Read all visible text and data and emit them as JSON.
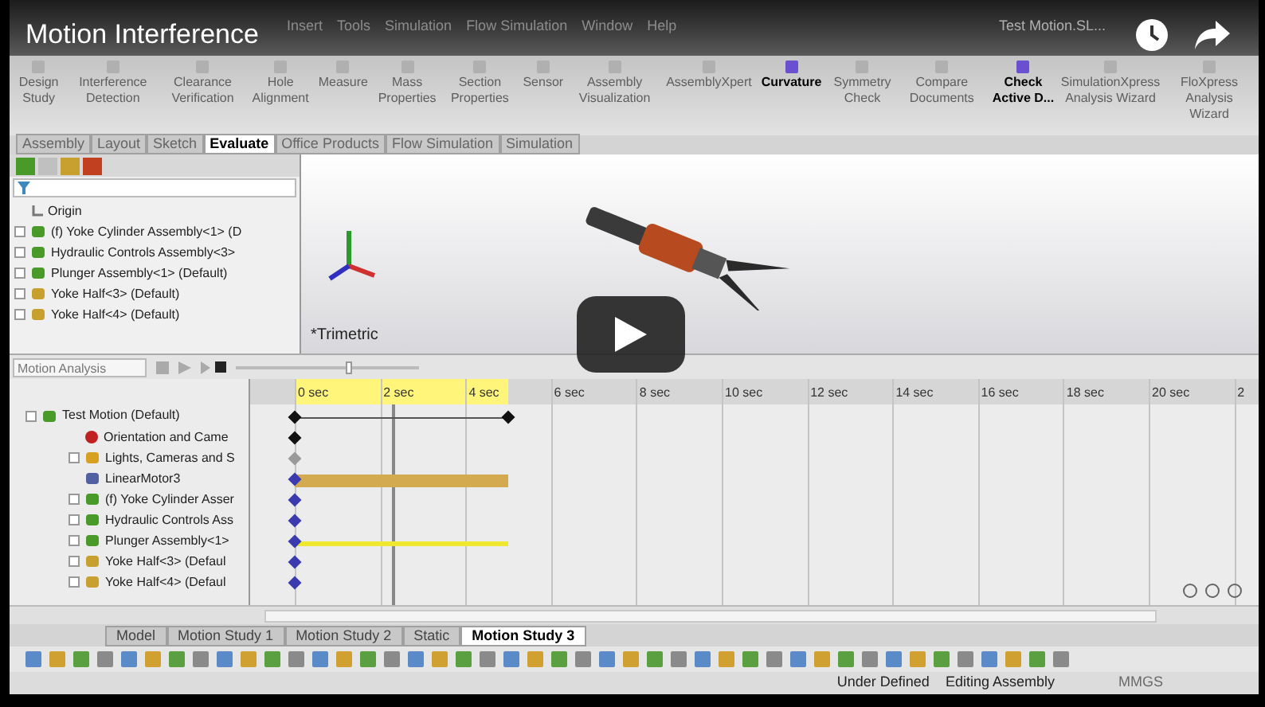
{
  "video": {
    "title": "Motion Interference"
  },
  "menu": [
    "Insert",
    "Tools",
    "Simulation",
    "Flow Simulation",
    "Window",
    "Help"
  ],
  "document_title": "Test Motion.SL...",
  "ribbon": [
    {
      "label": "Design Study",
      "disabled": true
    },
    {
      "label": "Interference Detection",
      "disabled": true
    },
    {
      "label": "Clearance Verification",
      "disabled": true
    },
    {
      "label": "Hole Alignment",
      "disabled": true
    },
    {
      "label": "Measure",
      "disabled": true
    },
    {
      "label": "Mass Properties",
      "disabled": true
    },
    {
      "label": "Section Properties",
      "disabled": true
    },
    {
      "label": "Sensor",
      "disabled": true
    },
    {
      "label": "Assembly Visualization",
      "disabled": true
    },
    {
      "label": "AssemblyXpert",
      "disabled": true
    },
    {
      "label": "Curvature",
      "disabled": false
    },
    {
      "label": "Symmetry Check",
      "disabled": true
    },
    {
      "label": "Compare Documents",
      "disabled": true
    },
    {
      "label": "Check Active D...",
      "disabled": false
    },
    {
      "label": "SimulationXpress Analysis Wizard",
      "disabled": true
    },
    {
      "label": "FloXpress Analysis Wizard",
      "disabled": true
    }
  ],
  "tabs": [
    {
      "label": "Assembly",
      "selected": false
    },
    {
      "label": "Layout",
      "selected": false
    },
    {
      "label": "Sketch",
      "selected": false
    },
    {
      "label": "Evaluate",
      "selected": true
    },
    {
      "label": "Office Products",
      "selected": false
    },
    {
      "label": "Flow Simulation",
      "selected": false
    },
    {
      "label": "Simulation",
      "selected": false
    }
  ],
  "feature_tree": {
    "items": [
      {
        "label": "Origin",
        "kind": "origin"
      },
      {
        "label": "(f) Yoke Cylinder Assembly<1> (D",
        "kind": "assembly"
      },
      {
        "label": "Hydraulic Controls Assembly<3>",
        "kind": "assembly"
      },
      {
        "label": "Plunger Assembly<1> (Default)",
        "kind": "assembly"
      },
      {
        "label": "Yoke Half<3> (Default)",
        "kind": "part"
      },
      {
        "label": "Yoke Half<4> (Default)",
        "kind": "part"
      }
    ]
  },
  "viewport": {
    "view_label": "*Trimetric"
  },
  "motion": {
    "study_type": "Motion Analysis",
    "slider": {
      "level": 0.6
    },
    "time_labels": [
      "0 sec",
      "2 sec",
      "4 sec",
      "6 sec",
      "8 sec",
      "10 sec",
      "12 sec",
      "14 sec",
      "16 sec",
      "18 sec",
      "20 sec",
      "2"
    ],
    "playhead": {
      "level": 0.14
    },
    "tree": [
      {
        "label": "Test Motion  (Default)",
        "kind": "assembly",
        "children": [
          {
            "label": "Orientation and Came",
            "kind": "camera"
          },
          {
            "label": "Lights, Cameras and S",
            "kind": "folder"
          },
          {
            "label": "LinearMotor3",
            "kind": "motor"
          },
          {
            "label": "(f) Yoke Cylinder Asser",
            "kind": "assembly"
          },
          {
            "label": "Hydraulic Controls Ass",
            "kind": "assembly"
          },
          {
            "label": "Plunger Assembly<1>",
            "kind": "assembly"
          },
          {
            "label": "Yoke Half<3> (Defaul",
            "kind": "part"
          },
          {
            "label": "Yoke Half<4> (Defaul",
            "kind": "part"
          }
        ]
      }
    ],
    "tracks": [
      {
        "kind": "span",
        "color": "#111111"
      },
      {
        "kind": "key",
        "color": "#111111"
      },
      {
        "kind": "key",
        "color": "#9a9a9a"
      },
      {
        "kind": "bar",
        "color": "#3b3bb0"
      },
      {
        "kind": "key",
        "color": "#3b3bb0"
      },
      {
        "kind": "key",
        "color": "#3b3bb0"
      },
      {
        "kind": "line",
        "color": "#3b3bb0"
      },
      {
        "kind": "key",
        "color": "#3b3bb0"
      },
      {
        "kind": "key",
        "color": "#3b3bb0"
      }
    ]
  },
  "study_tabs": [
    {
      "label": "Model",
      "selected": false
    },
    {
      "label": "Motion Study 1",
      "selected": false
    },
    {
      "label": "Motion Study 2",
      "selected": false
    },
    {
      "label": "Static",
      "selected": false
    },
    {
      "label": "Motion Study 3",
      "selected": true
    }
  ],
  "status_bar": {
    "state": "Under Defined",
    "mode": "Editing Assembly",
    "units": "MMGS"
  }
}
